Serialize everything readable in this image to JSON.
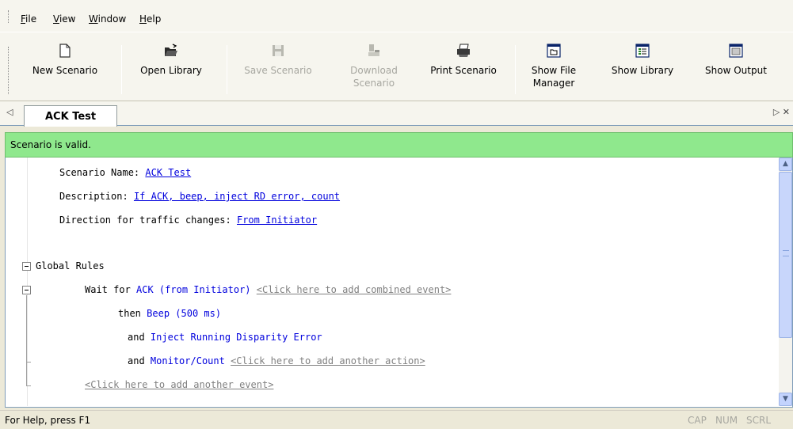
{
  "menu": [
    {
      "key": "F",
      "rest": "ile"
    },
    {
      "key": "V",
      "rest": "iew"
    },
    {
      "key": "W",
      "rest": "indow"
    },
    {
      "key": "H",
      "rest": "elp"
    }
  ],
  "toolbar": {
    "new_scenario": "New Scenario",
    "open_library": "Open Library",
    "save_scenario": "Save Scenario",
    "download_scenario_1": "Download",
    "download_scenario_2": "Scenario",
    "print_scenario": "Print Scenario",
    "show_file_manager_1": "Show File",
    "show_file_manager_2": "Manager",
    "show_library": "Show Library",
    "show_output": "Show Output"
  },
  "tabs": [
    {
      "label": "ACK Test",
      "active": true
    }
  ],
  "validity": {
    "message": "Scenario is valid.",
    "color": "#8fe88d"
  },
  "scenario": {
    "name_label": "Scenario Name:",
    "name_value": "ACK Test",
    "description_label": "Description:",
    "description_value": "If ACK, beep, inject RD error, count",
    "direction_label": "Direction for traffic changes:",
    "direction_value": "From Initiator"
  },
  "rules": {
    "header": "Global Rules",
    "wait_for": "Wait for",
    "event": "ACK (from Initiator)",
    "add_combined": "<Click here to add combined event>",
    "then": "then",
    "action1": "Beep (500 ms)",
    "and1": "and",
    "action2": "Inject Running Disparity Error",
    "and2": "and",
    "action3": "Monitor/Count",
    "add_action": "<Click here to add another action>",
    "add_event": "<Click here to add another event>"
  },
  "status": {
    "help": "For Help, press F1",
    "cap": "CAP",
    "num": "NUM",
    "scrl": "SCRL"
  }
}
